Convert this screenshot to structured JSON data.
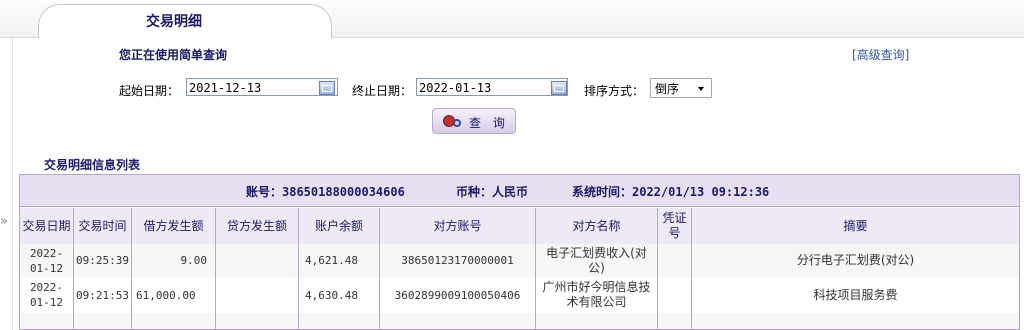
{
  "tab": {
    "title": "交易明细"
  },
  "search": {
    "mode_label": "您正在使用简单查询",
    "advanced_link": "[高级查询]",
    "start_label": "起始日期：",
    "start_value": "2021-12-13",
    "end_label": "终止日期：",
    "end_value": "2022-01-13",
    "sort_label": "排序方式：",
    "sort_value": "倒序",
    "query_button": "查 询"
  },
  "list": {
    "title": "交易明细信息列表",
    "account_info": "账号：38650188000034606",
    "currency_info": "币种：人民币",
    "system_time": "系统时间：2022/01/13 09:12:36",
    "headers": [
      "交易日期",
      "交易时间",
      "借方发生额",
      "贷方发生额",
      "账户余额",
      "对方账号",
      "对方名称",
      "凭证号",
      "摘要"
    ],
    "rows": [
      {
        "date": "2022-01-12",
        "time": "09:25:39",
        "debit": "9.00",
        "credit": "",
        "balance": "4,621.48",
        "counter_account": "38650123170000001",
        "counter_name": "电子汇划费收入(对公)",
        "voucher": "",
        "summary": "分行电子汇划费(对公)"
      },
      {
        "date": "2022-01-12",
        "time": "09:21:53",
        "debit": "61,000.00",
        "credit": "",
        "balance": "4,630.48",
        "counter_account": "3602899009100050406",
        "counter_name": "广州市好今明信息技术有限公司",
        "voucher": "",
        "summary": "科技项目服务费"
      }
    ]
  },
  "icons": {
    "calendar": "calendar-icon",
    "query": "magnifier-icon",
    "expand": "double-chevron-right-icon"
  },
  "colors": {
    "header_bg": "#e7dff1",
    "border": "#b8a4cc",
    "title": "#1a1a66",
    "link": "#3355aa"
  }
}
